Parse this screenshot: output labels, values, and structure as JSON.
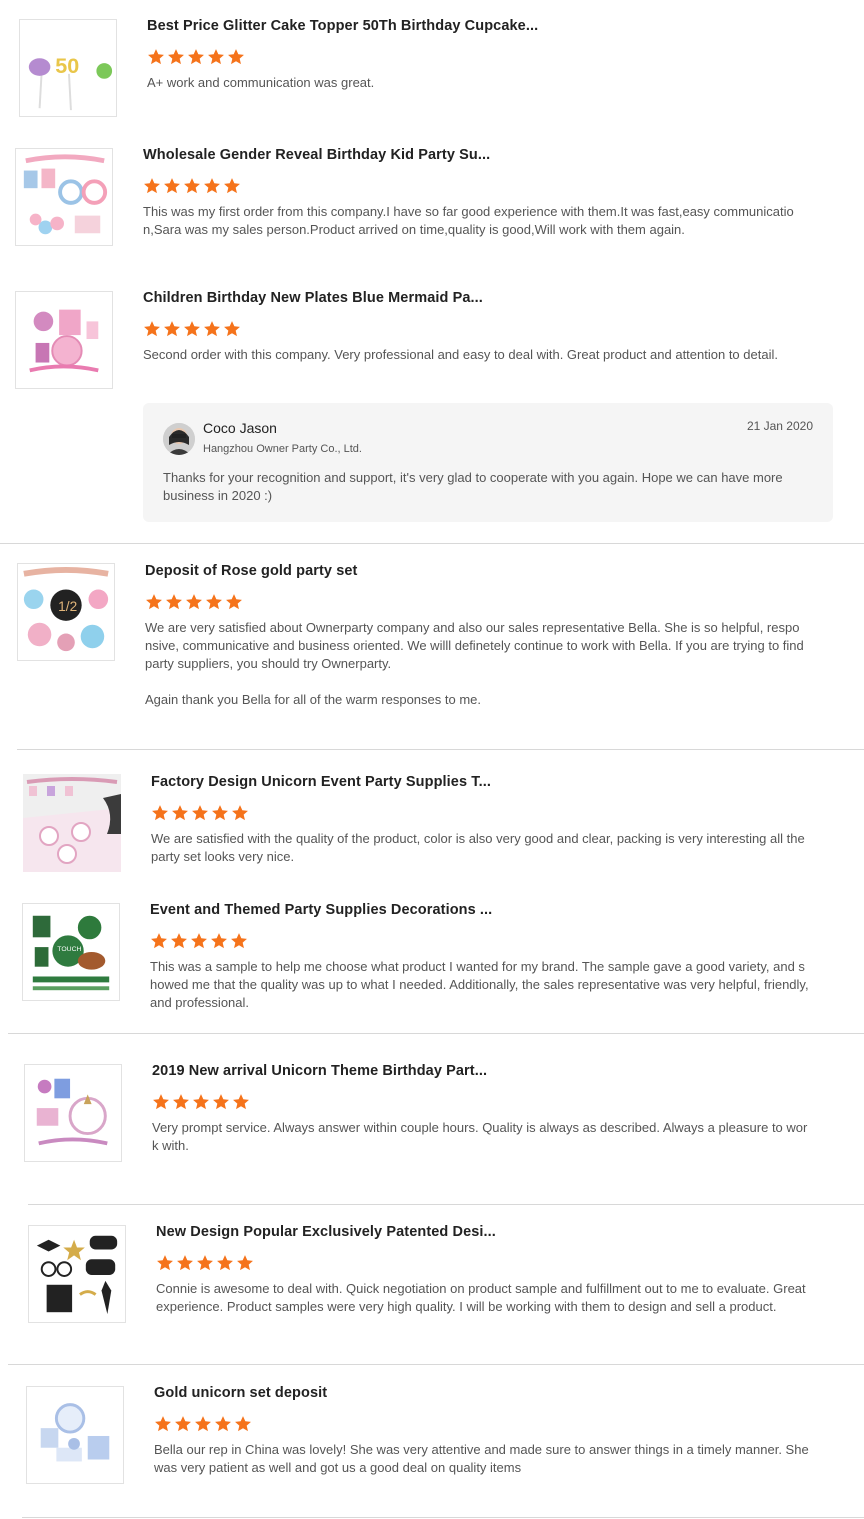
{
  "colors": {
    "star": "#f5731b",
    "divider": "#d8d8d8",
    "reply_bg": "#f5f5f5"
  },
  "reviews": [
    {
      "title": "Best Price Glitter Cake Topper 50Th Birthday Cupcake...",
      "rating": 5,
      "text": "A+ work and communication was great.",
      "thumb_icon": "cake-topper-icon"
    },
    {
      "title": "Wholesale Gender Reveal Birthday Kid Party Su...",
      "rating": 5,
      "text": "This was my first order from this company.I have so far good experience with them.It was fast,easy communication,Sara was my sales person.Product arrived on time,quality is good,Will work with them again.",
      "thumb_icon": "gender-reveal-set-icon"
    },
    {
      "title": "Children Birthday New Plates Blue Mermaid Pa...",
      "rating": 5,
      "text": "Second order with this company.  Very professional and easy to deal with.  Great product and attention to detail.",
      "thumb_icon": "mermaid-plates-icon"
    },
    {
      "title": "Deposit of Rose gold party set",
      "rating": 5,
      "text": "We are very satisfied about Ownerparty company and also our sales representative Bella. She is so helpful, responsive, communicative and business oriented. We willl definetely continue to work with Bella. If you are trying to find party suppliers, you should try Ownerparty.",
      "text2": "Again thank you Bella for all of the warm responses to me.",
      "thumb_icon": "rose-gold-set-icon"
    },
    {
      "title": "Factory Design Unicorn Event Party Supplies T...",
      "rating": 5,
      "text": "We are satisfied with the quality of the product, color is also very good and clear, packing is very interesting all the party set looks very nice.",
      "thumb_icon": "unicorn-table-icon"
    },
    {
      "title": "Event and Themed Party Supplies Decorations ...",
      "rating": 5,
      "text": "This was a sample to help me choose what product I wanted for my brand.  The sample gave a good variety, and showed me that the quality was up to what I needed.  Additionally, the sales representative was very helpful, friendly, and professional.",
      "thumb_icon": "football-party-icon"
    },
    {
      "title": "2019 New arrival Unicorn Theme Birthday Part...",
      "rating": 5,
      "text": "Very prompt service. Always answer within couple hours. Quality is always as described. Always a pleasure to work with.",
      "thumb_icon": "unicorn-theme-icon"
    },
    {
      "title": "New Design Popular Exclusively Patented Desi...",
      "rating": 5,
      "text": "Connie is awesome to deal with. Quick negotiation on product sample and fulfillment out to me to evaluate. Great experience. Product samples were very high quality. I will be working with them to design and sell a product.",
      "thumb_icon": "photo-booth-props-icon"
    },
    {
      "title": "Gold unicorn set deposit",
      "rating": 5,
      "text": "Bella our rep in China was lovely! She was very attentive and made sure to answer things in a timely manner. She was very patient as well and got us a good deal on quality items",
      "thumb_icon": "gold-unicorn-set-icon"
    }
  ],
  "reply": {
    "name": "Coco Jason",
    "company": "Hangzhou Owner Party Co., Ltd.",
    "date": "21 Jan 2020",
    "text": "Thanks for your recognition and support, it's very glad to cooperate with you again. Hope we can have more business in 2020 :)"
  }
}
